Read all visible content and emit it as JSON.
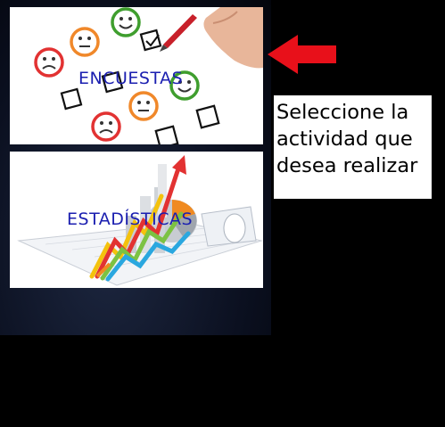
{
  "cards": {
    "encuestas": {
      "label": "ENCUESTAS"
    },
    "estadisticas": {
      "label": "ESTADÍSTICAS"
    }
  },
  "instruction": {
    "line1": "Seleccione la",
    "line2": "actividad que",
    "line3": "desea realizar"
  },
  "colors": {
    "label": "#1b1fb0",
    "arrow": "#e8101a",
    "background": "#000000"
  },
  "icons": [
    "red-arrow-left-icon"
  ]
}
